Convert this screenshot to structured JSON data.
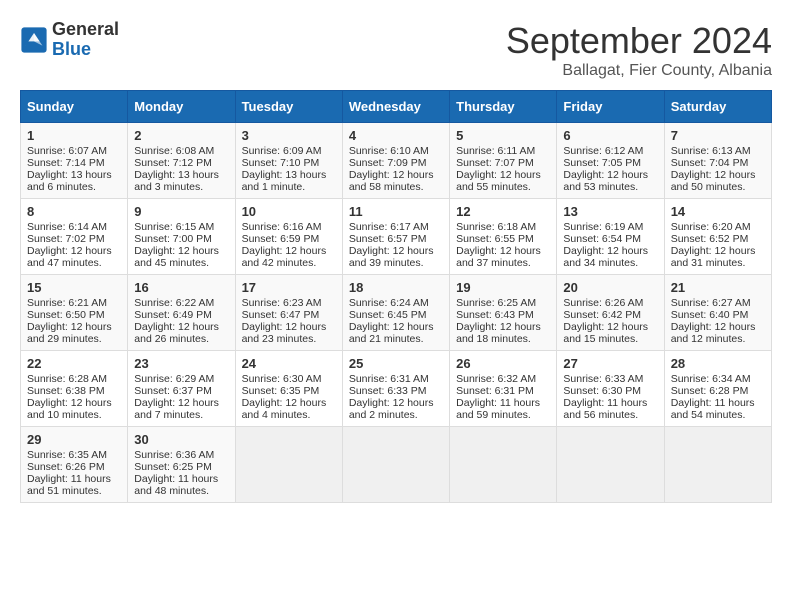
{
  "logo": {
    "general": "General",
    "blue": "Blue"
  },
  "title": "September 2024",
  "subtitle": "Ballagat, Fier County, Albania",
  "days": [
    "Sunday",
    "Monday",
    "Tuesday",
    "Wednesday",
    "Thursday",
    "Friday",
    "Saturday"
  ],
  "weeks": [
    [
      {
        "day": "1",
        "sunrise": "6:07 AM",
        "sunset": "7:14 PM",
        "daylight": "13 hours and 6 minutes."
      },
      {
        "day": "2",
        "sunrise": "6:08 AM",
        "sunset": "7:12 PM",
        "daylight": "13 hours and 3 minutes."
      },
      {
        "day": "3",
        "sunrise": "6:09 AM",
        "sunset": "7:10 PM",
        "daylight": "13 hours and 1 minute."
      },
      {
        "day": "4",
        "sunrise": "6:10 AM",
        "sunset": "7:09 PM",
        "daylight": "12 hours and 58 minutes."
      },
      {
        "day": "5",
        "sunrise": "6:11 AM",
        "sunset": "7:07 PM",
        "daylight": "12 hours and 55 minutes."
      },
      {
        "day": "6",
        "sunrise": "6:12 AM",
        "sunset": "7:05 PM",
        "daylight": "12 hours and 53 minutes."
      },
      {
        "day": "7",
        "sunrise": "6:13 AM",
        "sunset": "7:04 PM",
        "daylight": "12 hours and 50 minutes."
      }
    ],
    [
      {
        "day": "8",
        "sunrise": "6:14 AM",
        "sunset": "7:02 PM",
        "daylight": "12 hours and 47 minutes."
      },
      {
        "day": "9",
        "sunrise": "6:15 AM",
        "sunset": "7:00 PM",
        "daylight": "12 hours and 45 minutes."
      },
      {
        "day": "10",
        "sunrise": "6:16 AM",
        "sunset": "6:59 PM",
        "daylight": "12 hours and 42 minutes."
      },
      {
        "day": "11",
        "sunrise": "6:17 AM",
        "sunset": "6:57 PM",
        "daylight": "12 hours and 39 minutes."
      },
      {
        "day": "12",
        "sunrise": "6:18 AM",
        "sunset": "6:55 PM",
        "daylight": "12 hours and 37 minutes."
      },
      {
        "day": "13",
        "sunrise": "6:19 AM",
        "sunset": "6:54 PM",
        "daylight": "12 hours and 34 minutes."
      },
      {
        "day": "14",
        "sunrise": "6:20 AM",
        "sunset": "6:52 PM",
        "daylight": "12 hours and 31 minutes."
      }
    ],
    [
      {
        "day": "15",
        "sunrise": "6:21 AM",
        "sunset": "6:50 PM",
        "daylight": "12 hours and 29 minutes."
      },
      {
        "day": "16",
        "sunrise": "6:22 AM",
        "sunset": "6:49 PM",
        "daylight": "12 hours and 26 minutes."
      },
      {
        "day": "17",
        "sunrise": "6:23 AM",
        "sunset": "6:47 PM",
        "daylight": "12 hours and 23 minutes."
      },
      {
        "day": "18",
        "sunrise": "6:24 AM",
        "sunset": "6:45 PM",
        "daylight": "12 hours and 21 minutes."
      },
      {
        "day": "19",
        "sunrise": "6:25 AM",
        "sunset": "6:43 PM",
        "daylight": "12 hours and 18 minutes."
      },
      {
        "day": "20",
        "sunrise": "6:26 AM",
        "sunset": "6:42 PM",
        "daylight": "12 hours and 15 minutes."
      },
      {
        "day": "21",
        "sunrise": "6:27 AM",
        "sunset": "6:40 PM",
        "daylight": "12 hours and 12 minutes."
      }
    ],
    [
      {
        "day": "22",
        "sunrise": "6:28 AM",
        "sunset": "6:38 PM",
        "daylight": "12 hours and 10 minutes."
      },
      {
        "day": "23",
        "sunrise": "6:29 AM",
        "sunset": "6:37 PM",
        "daylight": "12 hours and 7 minutes."
      },
      {
        "day": "24",
        "sunrise": "6:30 AM",
        "sunset": "6:35 PM",
        "daylight": "12 hours and 4 minutes."
      },
      {
        "day": "25",
        "sunrise": "6:31 AM",
        "sunset": "6:33 PM",
        "daylight": "12 hours and 2 minutes."
      },
      {
        "day": "26",
        "sunrise": "6:32 AM",
        "sunset": "6:31 PM",
        "daylight": "11 hours and 59 minutes."
      },
      {
        "day": "27",
        "sunrise": "6:33 AM",
        "sunset": "6:30 PM",
        "daylight": "11 hours and 56 minutes."
      },
      {
        "day": "28",
        "sunrise": "6:34 AM",
        "sunset": "6:28 PM",
        "daylight": "11 hours and 54 minutes."
      }
    ],
    [
      {
        "day": "29",
        "sunrise": "6:35 AM",
        "sunset": "6:26 PM",
        "daylight": "11 hours and 51 minutes."
      },
      {
        "day": "30",
        "sunrise": "6:36 AM",
        "sunset": "6:25 PM",
        "daylight": "11 hours and 48 minutes."
      },
      null,
      null,
      null,
      null,
      null
    ]
  ],
  "labels": {
    "sunrise": "Sunrise:",
    "sunset": "Sunset:",
    "daylight": "Daylight:"
  }
}
